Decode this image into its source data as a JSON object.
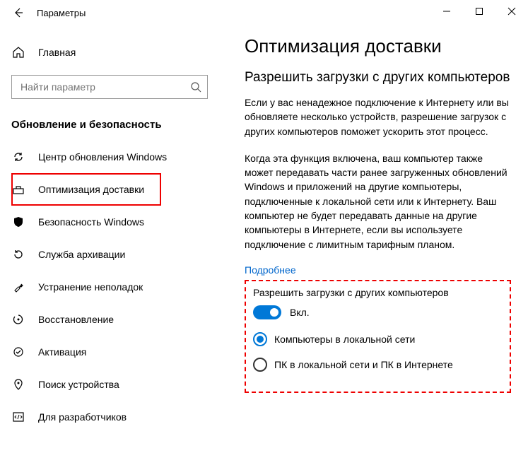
{
  "titlebar": {
    "title": "Параметры"
  },
  "sidebar": {
    "home": "Главная",
    "search_placeholder": "Найти параметр",
    "section": "Обновление и безопасность",
    "items": [
      {
        "label": "Центр обновления Windows"
      },
      {
        "label": "Оптимизация доставки"
      },
      {
        "label": "Безопасность Windows"
      },
      {
        "label": "Служба архивации"
      },
      {
        "label": "Устранение неполадок"
      },
      {
        "label": "Восстановление"
      },
      {
        "label": "Активация"
      },
      {
        "label": "Поиск устройства"
      },
      {
        "label": "Для разработчиков"
      }
    ]
  },
  "content": {
    "h1": "Оптимизация доставки",
    "h2": "Разрешить загрузки с других компьютеров",
    "p1": "Если у вас ненадежное подключение к Интернету или вы обновляете несколько устройств, разрешение загрузок с других компьютеров поможет ускорить этот процесс.",
    "p2": "Когда эта функция включена, ваш компьютер также может передавать части ранее загруженных обновлений Windows и приложений на другие компьютеры, подключенные к локальной сети или к Интернету. Ваш компьютер не будет передавать данные на другие компьютеры в Интернете, если вы используете подключение с лимитным тарифным планом.",
    "more": "Подробнее",
    "toggle": {
      "label": "Разрешить загрузки с других компьютеров",
      "state": "Вкл."
    },
    "radio1": "Компьютеры в локальной сети",
    "radio2": "ПК в локальной сети и ПК в Интернете"
  }
}
